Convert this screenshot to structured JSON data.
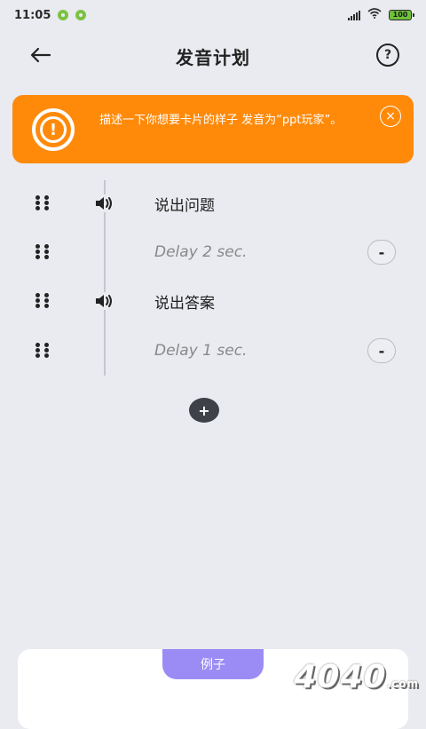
{
  "status_bar": {
    "time": "11:05",
    "battery": "100"
  },
  "header": {
    "title": "发音计划",
    "back_icon": "arrow-left-icon",
    "help_label": "?"
  },
  "banner": {
    "text": "描述一下你想要卡片的样子 发音为“ppt玩家”。",
    "alert_icon": "!",
    "close_icon": "×",
    "color": "#ff8a0a"
  },
  "plan": {
    "rows": [
      {
        "type": "speak",
        "label": "说出问题"
      },
      {
        "type": "delay",
        "label": "Delay 2 sec.",
        "remove": "-"
      },
      {
        "type": "speak",
        "label": "说出答案"
      },
      {
        "type": "delay",
        "label": "Delay 1 sec.",
        "remove": "-"
      }
    ],
    "add_label": "+"
  },
  "example": {
    "tab_label": "例子"
  },
  "watermark": {
    "text": "4040",
    "suffix": ".com"
  }
}
